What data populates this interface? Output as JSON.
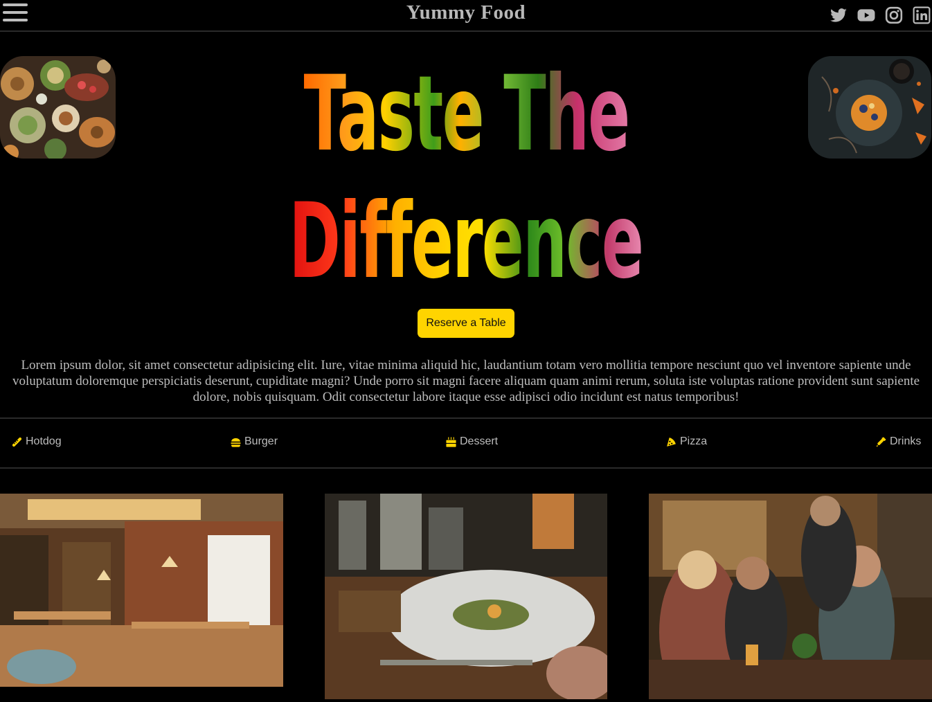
{
  "header": {
    "brand": "Yummy Food",
    "menu_icon": "hamburger-menu-icon",
    "socials": [
      {
        "name": "twitter-icon"
      },
      {
        "name": "youtube-icon"
      },
      {
        "name": "instagram-icon"
      },
      {
        "name": "linkedin-icon"
      }
    ]
  },
  "hero": {
    "line1": "Taste The",
    "line2": "Difference",
    "reserve_label": "Reserve a Table",
    "description": "Lorem ipsum dolor, sit amet consectetur adipisicing elit. Iure, vitae minima aliquid hic, laudantium totam vero mollitia tempore nesciunt quo vel inventore sapiente unde voluptatum doloremque perspiciatis deserunt, cupiditate magni? Unde porro sit magni facere aliquam quam animi rerum, soluta iste voluptas ratione provident sunt sapiente dolore, nobis quisquam. Odit consectetur labore itaque esse adipisci odio incidunt est natus temporibus!"
  },
  "categories": [
    {
      "label": "Hotdog",
      "icon": "hotdog-icon"
    },
    {
      "label": "Burger",
      "icon": "burger-icon"
    },
    {
      "label": "Dessert",
      "icon": "cake-icon"
    },
    {
      "label": "Pizza",
      "icon": "pizza-icon"
    },
    {
      "label": "Drinks",
      "icon": "bottle-icon"
    }
  ],
  "colors": {
    "accent": "#ffd400",
    "background": "#000000",
    "text_muted": "#bdbdbd"
  }
}
